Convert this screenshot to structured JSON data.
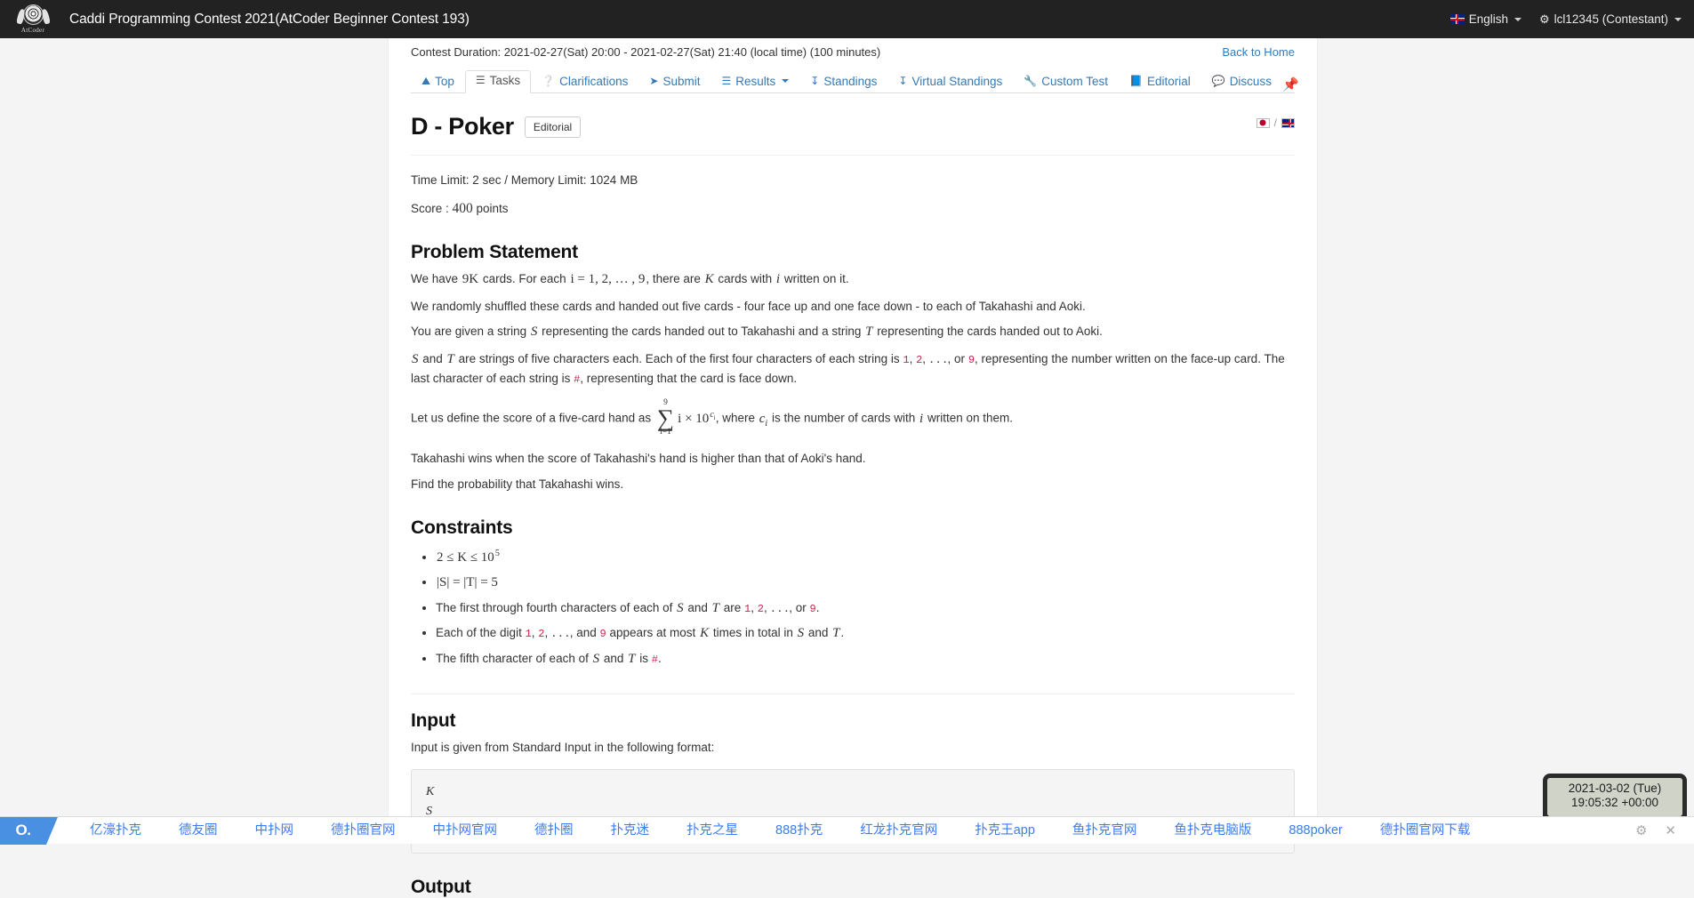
{
  "navbar": {
    "logo_word": "AtCoder",
    "contest_title": "Caddi Programming Contest 2021(AtCoder Beginner Contest 193)",
    "language_label": "English",
    "user_label": "lcl12345 (Contestant)"
  },
  "contest": {
    "duration_text": "Contest Duration: 2021-02-27(Sat) 20:00 - 2021-02-27(Sat) 21:40 (local time) (100 minutes)",
    "back_to_home": "Back to Home"
  },
  "tabs": [
    {
      "label": "Top",
      "icon": "home-icon",
      "glyph": "⌂",
      "active": false
    },
    {
      "label": "Tasks",
      "icon": "list-icon",
      "glyph": "☰",
      "active": true
    },
    {
      "label": "Clarifications",
      "icon": "question-circle-icon",
      "glyph": "❓",
      "active": false
    },
    {
      "label": "Submit",
      "icon": "paper-plane-icon",
      "glyph": "➤",
      "active": false
    },
    {
      "label": "Results",
      "icon": "list-ul-icon",
      "glyph": "☰",
      "active": false,
      "caret": true
    },
    {
      "label": "Standings",
      "icon": "sort-amount-icon",
      "glyph": "↓",
      "active": false
    },
    {
      "label": "Virtual Standings",
      "icon": "sort-amount-icon",
      "glyph": "↓",
      "active": false
    },
    {
      "label": "Custom Test",
      "icon": "wrench-icon",
      "glyph": "⚒",
      "active": false
    },
    {
      "label": "Editorial",
      "icon": "book-icon",
      "glyph": "■",
      "active": false
    },
    {
      "label": "Discuss",
      "icon": "comment-icon",
      "glyph": "▬",
      "active": false
    }
  ],
  "pin_icon": "pushpin-icon",
  "problem": {
    "title": "D - Poker",
    "editorial_button": "Editorial",
    "time_memory": "Time Limit: 2 sec / Memory Limit: 1024 MB",
    "score_prefix": "Score : ",
    "score_value": "400",
    "score_suffix": " points",
    "lang_jp_icon": "japan-flag-icon",
    "lang_en_icon": "uk-flag-icon",
    "lang_separator": "/"
  },
  "sections": {
    "problem_statement_heading": "Problem Statement",
    "constraints_heading": "Constraints",
    "input_heading": "Input",
    "output_heading": "Output",
    "input_intro": "Input is given from Standard Input in the following format:",
    "input_format": "K\nS\nT"
  },
  "statement_paragraphs": {
    "p1": {
      "a": "We have ",
      "b": "9K",
      "c": " cards. For each ",
      "d": "i = 1, 2, … , 9",
      "e": ", there are ",
      "f": "K",
      "g": " cards with ",
      "h": "i",
      "i": " written on it."
    },
    "p2": "We randomly shuffled these cards and handed out five cards - four face up and one face down - to each of Takahashi and Aoki.",
    "p3": {
      "a": "You are given a string ",
      "b": "S",
      "c": " representing the cards handed out to Takahashi and a string ",
      "d": "T",
      "e": " representing the cards handed out to Aoki."
    },
    "p4": {
      "a": "S",
      "b": " and ",
      "c": "T",
      "d": " are strings of five characters each. Each of the first four characters of each string is ",
      "e": "1",
      "f": "2",
      "g": "9",
      "h": ", representing the number written on the face-up card. The last character of each string is ",
      "i": "#",
      "j": ", representing that the card is face down."
    },
    "p5": {
      "a": "Let us define the score of a five-card hand as ",
      "sum_upper": "9",
      "sum_lower": "i=1",
      "b": "i × 10",
      "exp": "ci",
      "c": ", where ",
      "d": "ci",
      "e": " is the number of cards with ",
      "f": "i",
      "g": " written on them."
    },
    "p6": "Takahashi wins when the score of Takahashi's hand is higher than that of Aoki's hand.",
    "p7": "Find the probability that Takahashi wins."
  },
  "constraints": {
    "c1": {
      "lhs": "2 ≤ K ≤ 10",
      "exp": "5"
    },
    "c2": "|S| = |T| = 5",
    "c3": {
      "a": "The first through fourth characters of each of ",
      "b": "S",
      "c": " and ",
      "d": "T",
      "e": " are ",
      "f": "1",
      "g": "2",
      "h": "9",
      "i": "."
    },
    "c4": {
      "a": "Each of the digit ",
      "b": "1",
      "c": "2",
      "d": ", and ",
      "e": "9",
      "f": " appears at most ",
      "g": "K",
      "h": " times in total in ",
      "i": "S",
      "j": " and ",
      "k": "T",
      "l": "."
    },
    "c5": {
      "a": "The fifth character of each of ",
      "b": "S",
      "c": " and ",
      "d": "T",
      "e": " is ",
      "f": "#",
      "g": "."
    }
  },
  "bottombar": {
    "logo_text": "O.",
    "links": [
      "亿濠扑克",
      "德友圈",
      "中扑网",
      "德扑圈官网",
      "中扑网官网",
      "德扑圈",
      "扑克迷",
      "扑克之星",
      "888扑克",
      "红龙扑克官网",
      "扑克王app",
      "鱼扑克官网",
      "鱼扑克电脑版",
      "888poker",
      "德扑圈官网下载"
    ],
    "settings_icon": "gear-icon",
    "close_icon": "close-icon"
  },
  "clock": {
    "date": "2021-03-02 (Tue)",
    "time": "19:05:32 +00:00"
  },
  "colors": {
    "navbar_bg": "#222222",
    "link_blue": "#337ab7",
    "bookmark_blue": "#3b7cf0",
    "code_red": "#c7254e",
    "page_bg": "#f4f4f4"
  }
}
